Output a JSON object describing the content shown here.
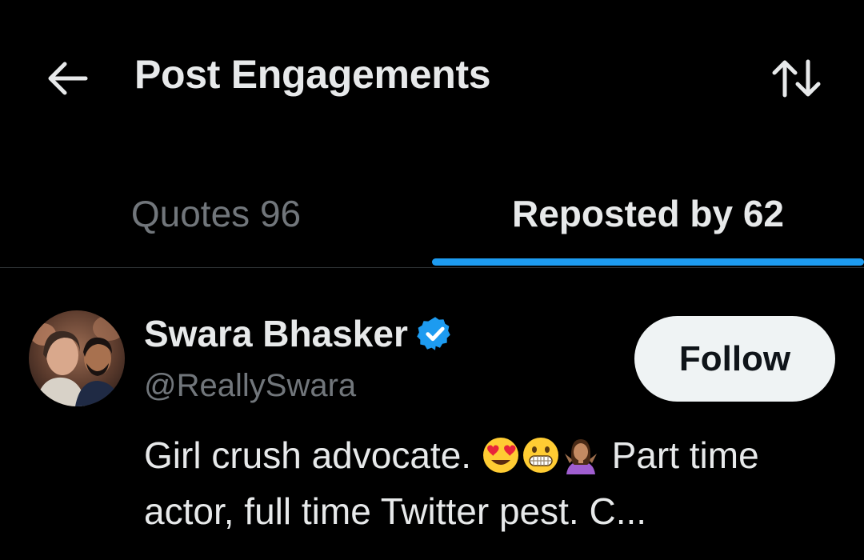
{
  "header": {
    "title": "Post Engagements",
    "back_icon": "arrow-left-icon",
    "sort_icon": "sort-arrows-icon"
  },
  "tabs": [
    {
      "label": "Quotes 96",
      "active": false
    },
    {
      "label": "Reposted by 62",
      "active": true
    }
  ],
  "user": {
    "display_name": "Swara Bhasker",
    "verified": true,
    "handle": "@ReallySwara",
    "follow_label": "Follow",
    "bio_start": "Girl crush advocate.",
    "bio_end": " Part time actor, full time Twitter pest. C..."
  },
  "colors": {
    "background": "#000000",
    "primary_text": "#e7e9ea",
    "secondary_text": "#71767b",
    "accent": "#1d9bf0",
    "follow_bg": "#eff3f4"
  }
}
